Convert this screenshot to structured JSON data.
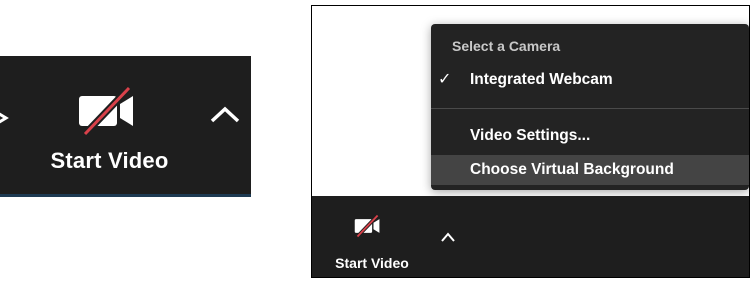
{
  "zoomed_toolbar": {
    "start_video_label": "Start Video",
    "icons": [
      "video-off-icon",
      "chevron-up-icon"
    ]
  },
  "screenshot": {
    "camera_menu": {
      "header": "Select a Camera",
      "items": [
        {
          "label": "Integrated Webcam",
          "checked": true,
          "check_glyph": "✓"
        },
        {
          "label": "Video Settings...",
          "checked": false
        },
        {
          "label": "Choose Virtual Background",
          "checked": false,
          "highlighted": true
        }
      ]
    },
    "toolbar": {
      "start_video_label": "Start Video"
    }
  },
  "colors": {
    "toolbar_bg": "#1e1e1e",
    "menu_bg": "#232323",
    "menu_highlight": "#444444",
    "slash_red": "#d9414a",
    "text_white": "#ffffff"
  }
}
